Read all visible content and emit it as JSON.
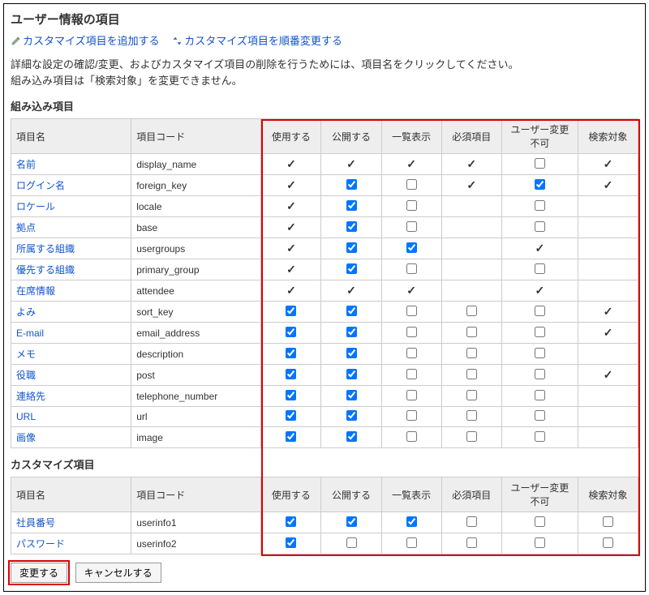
{
  "title": "ユーザー情報の項目",
  "actions": {
    "add": "カスタマイズ項目を追加する",
    "reorder": "カスタマイズ項目を順番変更する"
  },
  "desc1": "詳細な設定の確認/変更、およびカスタマイズ項目の削除を行うためには、項目名をクリックしてください。",
  "desc2": "組み込み項目は「検索対象」を変更できません。",
  "sectionBuiltin": "組み込み項目",
  "sectionCustom": "カスタマイズ項目",
  "headers": {
    "name": "項目名",
    "code": "項目コード",
    "use": "使用する",
    "publish": "公開する",
    "list": "一覧表示",
    "required": "必須項目",
    "locked": "ユーザー変更不可",
    "search": "検索対象"
  },
  "builtin": [
    {
      "name": "名前",
      "code": "display_name",
      "use": {
        "t": "tick",
        "v": true
      },
      "pub": {
        "t": "tick",
        "v": true
      },
      "list": {
        "t": "tick",
        "v": true
      },
      "req": {
        "t": "tick",
        "v": true
      },
      "lock": {
        "t": "cb",
        "v": false
      },
      "srch": {
        "t": "tick",
        "v": true
      }
    },
    {
      "name": "ログイン名",
      "code": "foreign_key",
      "use": {
        "t": "tick",
        "v": true
      },
      "pub": {
        "t": "cb",
        "v": true
      },
      "list": {
        "t": "cb",
        "v": false
      },
      "req": {
        "t": "tick",
        "v": true
      },
      "lock": {
        "t": "cb",
        "v": true
      },
      "srch": {
        "t": "tick",
        "v": true
      }
    },
    {
      "name": "ロケール",
      "code": "locale",
      "use": {
        "t": "tick",
        "v": true
      },
      "pub": {
        "t": "cb",
        "v": true
      },
      "list": {
        "t": "cb",
        "v": false
      },
      "req": {
        "t": "none"
      },
      "lock": {
        "t": "cb",
        "v": false
      },
      "srch": {
        "t": "none"
      }
    },
    {
      "name": "拠点",
      "code": "base",
      "use": {
        "t": "tick",
        "v": true
      },
      "pub": {
        "t": "cb",
        "v": true
      },
      "list": {
        "t": "cb",
        "v": false
      },
      "req": {
        "t": "none"
      },
      "lock": {
        "t": "cb",
        "v": false
      },
      "srch": {
        "t": "none"
      }
    },
    {
      "name": "所属する組織",
      "code": "usergroups",
      "use": {
        "t": "tick",
        "v": true
      },
      "pub": {
        "t": "cb",
        "v": true
      },
      "list": {
        "t": "cb",
        "v": true
      },
      "req": {
        "t": "none"
      },
      "lock": {
        "t": "tick",
        "v": true
      },
      "srch": {
        "t": "none"
      }
    },
    {
      "name": "優先する組織",
      "code": "primary_group",
      "use": {
        "t": "tick",
        "v": true
      },
      "pub": {
        "t": "cb",
        "v": true
      },
      "list": {
        "t": "cb",
        "v": false
      },
      "req": {
        "t": "none"
      },
      "lock": {
        "t": "cb",
        "v": false
      },
      "srch": {
        "t": "none"
      }
    },
    {
      "name": "在席情報",
      "code": "attendee",
      "use": {
        "t": "tick",
        "v": true
      },
      "pub": {
        "t": "tick",
        "v": true
      },
      "list": {
        "t": "tick",
        "v": true
      },
      "req": {
        "t": "none"
      },
      "lock": {
        "t": "tick",
        "v": true
      },
      "srch": {
        "t": "none"
      }
    },
    {
      "name": "よみ",
      "code": "sort_key",
      "use": {
        "t": "cb",
        "v": true
      },
      "pub": {
        "t": "cb",
        "v": true
      },
      "list": {
        "t": "cb",
        "v": false
      },
      "req": {
        "t": "cb",
        "v": false
      },
      "lock": {
        "t": "cb",
        "v": false
      },
      "srch": {
        "t": "tick",
        "v": true
      }
    },
    {
      "name": "E-mail",
      "code": "email_address",
      "use": {
        "t": "cb",
        "v": true
      },
      "pub": {
        "t": "cb",
        "v": true
      },
      "list": {
        "t": "cb",
        "v": false
      },
      "req": {
        "t": "cb",
        "v": false
      },
      "lock": {
        "t": "cb",
        "v": false
      },
      "srch": {
        "t": "tick",
        "v": true
      }
    },
    {
      "name": "メモ",
      "code": "description",
      "use": {
        "t": "cb",
        "v": true
      },
      "pub": {
        "t": "cb",
        "v": true
      },
      "list": {
        "t": "cb",
        "v": false
      },
      "req": {
        "t": "cb",
        "v": false
      },
      "lock": {
        "t": "cb",
        "v": false
      },
      "srch": {
        "t": "none"
      }
    },
    {
      "name": "役職",
      "code": "post",
      "use": {
        "t": "cb",
        "v": true
      },
      "pub": {
        "t": "cb",
        "v": true
      },
      "list": {
        "t": "cb",
        "v": false
      },
      "req": {
        "t": "cb",
        "v": false
      },
      "lock": {
        "t": "cb",
        "v": false
      },
      "srch": {
        "t": "tick",
        "v": true
      }
    },
    {
      "name": "連絡先",
      "code": "telephone_number",
      "use": {
        "t": "cb",
        "v": true
      },
      "pub": {
        "t": "cb",
        "v": true
      },
      "list": {
        "t": "cb",
        "v": false
      },
      "req": {
        "t": "cb",
        "v": false
      },
      "lock": {
        "t": "cb",
        "v": false
      },
      "srch": {
        "t": "none"
      }
    },
    {
      "name": "URL",
      "code": "url",
      "use": {
        "t": "cb",
        "v": true
      },
      "pub": {
        "t": "cb",
        "v": true
      },
      "list": {
        "t": "cb",
        "v": false
      },
      "req": {
        "t": "cb",
        "v": false
      },
      "lock": {
        "t": "cb",
        "v": false
      },
      "srch": {
        "t": "none"
      }
    },
    {
      "name": "画像",
      "code": "image",
      "use": {
        "t": "cb",
        "v": true
      },
      "pub": {
        "t": "cb",
        "v": true
      },
      "list": {
        "t": "cb",
        "v": false
      },
      "req": {
        "t": "cb",
        "v": false
      },
      "lock": {
        "t": "cb",
        "v": false
      },
      "srch": {
        "t": "none"
      }
    }
  ],
  "custom": [
    {
      "name": "社員番号",
      "code": "userinfo1",
      "use": {
        "t": "cb",
        "v": true
      },
      "pub": {
        "t": "cb",
        "v": true
      },
      "list": {
        "t": "cb",
        "v": true
      },
      "req": {
        "t": "cb",
        "v": false
      },
      "lock": {
        "t": "cb",
        "v": false
      },
      "srch": {
        "t": "cb",
        "v": false
      }
    },
    {
      "name": "パスワード",
      "code": "userinfo2",
      "use": {
        "t": "cb",
        "v": true
      },
      "pub": {
        "t": "cb",
        "v": false
      },
      "list": {
        "t": "cb",
        "v": false
      },
      "req": {
        "t": "cb",
        "v": false
      },
      "lock": {
        "t": "cb",
        "v": false
      },
      "srch": {
        "t": "cb",
        "v": false
      }
    }
  ],
  "buttons": {
    "save": "変更する",
    "cancel": "キャンセルする"
  }
}
